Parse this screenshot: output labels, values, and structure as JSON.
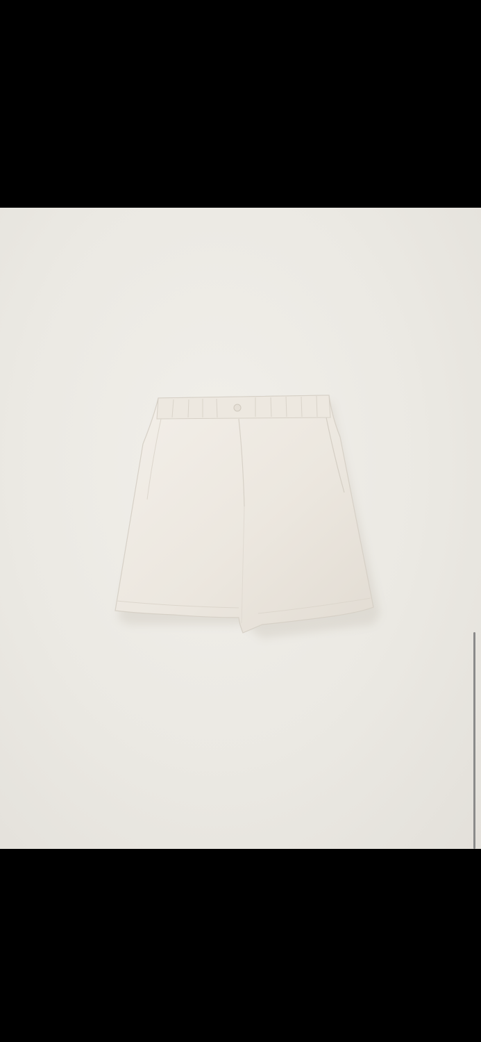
{
  "viewer": {
    "image_subject": "",
    "background_color": "#000000",
    "photo_background_color": "#ecEae4",
    "garment_color": "#efeae3",
    "scroll_indicator_color": "#8a8a8a",
    "scroll_position": 0.96
  }
}
